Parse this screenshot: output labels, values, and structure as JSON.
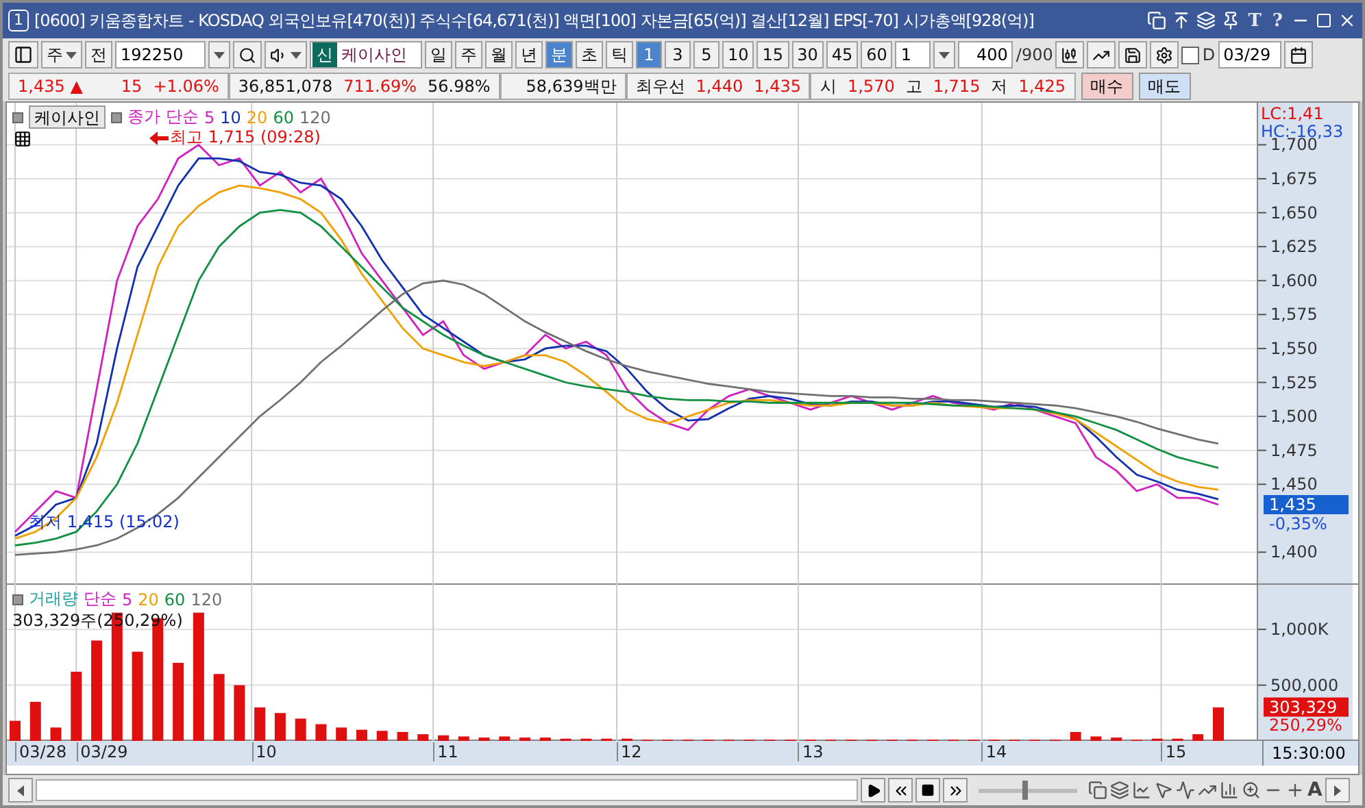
{
  "window": {
    "number": "1",
    "title": "[0600] 키움종합차트 - KOSDAQ 외국인보유[470(천)] 주식수[64,671(천)] 액면[100] 자본금[65(억)] 결산[12월] EPS[-70] 시가총액[928(억)]",
    "text_buttons": [
      "T",
      "?"
    ]
  },
  "toolbar": {
    "market": "주",
    "prev": "전",
    "code": "192250",
    "badge": "신",
    "name": "케이사인",
    "periods": [
      {
        "label": "일",
        "selected": false
      },
      {
        "label": "주",
        "selected": false
      },
      {
        "label": "월",
        "selected": false
      },
      {
        "label": "년",
        "selected": false
      },
      {
        "label": "분",
        "selected": true
      },
      {
        "label": "초",
        "selected": false
      },
      {
        "label": "틱",
        "selected": false
      }
    ],
    "intervals": [
      {
        "label": "1",
        "selected": true
      },
      {
        "label": "3",
        "selected": false
      },
      {
        "label": "5",
        "selected": false
      },
      {
        "label": "10",
        "selected": false
      },
      {
        "label": "15",
        "selected": false
      },
      {
        "label": "30",
        "selected": false
      },
      {
        "label": "45",
        "selected": false
      },
      {
        "label": "60",
        "selected": false
      }
    ],
    "unit": "1",
    "count": "400",
    "max": "/900",
    "d_checkbox": {
      "label": "D",
      "checked": false
    },
    "date": "03/29"
  },
  "quote": {
    "price": "1,435",
    "direction": "▲",
    "change": "15",
    "rate": "+1.06%",
    "volume": "36,851,078",
    "volume_rate": "711.69%",
    "turnover": "56.98%",
    "amount": "58,639백만",
    "best_label": "최우선",
    "best_ask": "1,440",
    "best_bid": "1,435",
    "open_label": "시",
    "open": "1,570",
    "high_label": "고",
    "high": "1,715",
    "low_label": "저",
    "low": "1,425"
  },
  "trade_buttons": [
    {
      "label": "매수",
      "kind": "buy"
    },
    {
      "label": "매도",
      "kind": "sell"
    }
  ],
  "price_pane": {
    "stock_button": "케이사인",
    "legend_prefix": [
      "종가",
      "단순"
    ],
    "markers": [
      {
        "text": "최고 1,715 (09:28)",
        "kind": "high"
      },
      {
        "text": "최저 1,415 (15:02)",
        "kind": "low"
      }
    ],
    "lc": "LC:1,41",
    "hc": "HC:-16,33",
    "current": "1,435",
    "current_rate": "-0,35%",
    "chart_data": {
      "type": "line",
      "grid": true,
      "ylim": [
        1376,
        1731
      ],
      "yticks": [
        {
          "value": 1400,
          "label": "1,400"
        },
        {
          "value": 1450,
          "label": "1,450"
        },
        {
          "value": 1475,
          "label": "1,475"
        },
        {
          "value": 1500,
          "label": "1,500"
        },
        {
          "value": 1525,
          "label": "1,525"
        },
        {
          "value": 1550,
          "label": "1,550"
        },
        {
          "value": 1575,
          "label": "1,575"
        },
        {
          "value": 1600,
          "label": "1,600"
        },
        {
          "value": 1625,
          "label": "1,625"
        },
        {
          "value": 1650,
          "label": "1,650"
        },
        {
          "value": 1675,
          "label": "1,675"
        },
        {
          "value": 1700,
          "label": "1,700"
        }
      ],
      "series": [
        {
          "name": "5",
          "color": "#d020c0",
          "values": [
            1415,
            1430,
            1445,
            1440,
            1520,
            1600,
            1640,
            1660,
            1690,
            1700,
            1685,
            1690,
            1670,
            1680,
            1665,
            1675,
            1650,
            1620,
            1600,
            1580,
            1560,
            1570,
            1545,
            1535,
            1540,
            1545,
            1560,
            1550,
            1555,
            1545,
            1520,
            1505,
            1495,
            1490,
            1505,
            1515,
            1520,
            1515,
            1510,
            1505,
            1510,
            1515,
            1510,
            1505,
            1510,
            1515,
            1510,
            1508,
            1505,
            1510,
            1505,
            1500,
            1495,
            1470,
            1460,
            1445,
            1450,
            1440,
            1440,
            1435
          ]
        },
        {
          "name": "10",
          "color": "#1030b0",
          "values": [
            1412,
            1420,
            1435,
            1440,
            1480,
            1550,
            1610,
            1640,
            1670,
            1690,
            1690,
            1688,
            1680,
            1678,
            1672,
            1670,
            1660,
            1640,
            1615,
            1595,
            1575,
            1565,
            1555,
            1545,
            1540,
            1542,
            1550,
            1552,
            1552,
            1548,
            1535,
            1518,
            1505,
            1497,
            1498,
            1506,
            1513,
            1515,
            1513,
            1509,
            1508,
            1511,
            1511,
            1508,
            1508,
            1511,
            1511,
            1509,
            1507,
            1508,
            1507,
            1503,
            1498,
            1485,
            1470,
            1457,
            1452,
            1446,
            1443,
            1439
          ]
        },
        {
          "name": "20",
          "color": "#f0a000",
          "values": [
            1410,
            1415,
            1425,
            1440,
            1470,
            1510,
            1560,
            1610,
            1640,
            1655,
            1665,
            1670,
            1668,
            1665,
            1660,
            1650,
            1630,
            1605,
            1585,
            1565,
            1550,
            1545,
            1540,
            1537,
            1540,
            1545,
            1545,
            1540,
            1530,
            1518,
            1505,
            1498,
            1495,
            1500,
            1505,
            1510,
            1512,
            1512,
            1510,
            1508,
            1508,
            1510,
            1510,
            1508,
            1508,
            1510,
            1508,
            1507,
            1506,
            1506,
            1505,
            1502,
            1498,
            1488,
            1478,
            1468,
            1458,
            1452,
            1448,
            1446
          ]
        },
        {
          "name": "60",
          "color": "#109040",
          "values": [
            1405,
            1407,
            1410,
            1415,
            1430,
            1450,
            1480,
            1520,
            1560,
            1600,
            1625,
            1640,
            1650,
            1652,
            1650,
            1640,
            1625,
            1610,
            1595,
            1580,
            1570,
            1560,
            1552,
            1545,
            1540,
            1535,
            1530,
            1525,
            1522,
            1520,
            1518,
            1515,
            1513,
            1512,
            1512,
            1511,
            1511,
            1510,
            1510,
            1510,
            1510,
            1510,
            1510,
            1510,
            1510,
            1509,
            1508,
            1508,
            1507,
            1506,
            1505,
            1503,
            1500,
            1495,
            1490,
            1483,
            1476,
            1470,
            1466,
            1462
          ]
        },
        {
          "name": "120",
          "color": "#707070",
          "values": [
            1398,
            1399,
            1400,
            1402,
            1405,
            1410,
            1418,
            1428,
            1440,
            1455,
            1470,
            1485,
            1500,
            1512,
            1525,
            1540,
            1552,
            1565,
            1578,
            1590,
            1598,
            1600,
            1597,
            1590,
            1580,
            1570,
            1562,
            1555,
            1548,
            1542,
            1537,
            1533,
            1530,
            1527,
            1524,
            1522,
            1520,
            1518,
            1517,
            1516,
            1515,
            1515,
            1514,
            1514,
            1513,
            1513,
            1512,
            1512,
            1511,
            1510,
            1509,
            1508,
            1506,
            1503,
            1500,
            1496,
            1491,
            1487,
            1483,
            1480
          ]
        }
      ]
    }
  },
  "volume_pane": {
    "legend": [
      {
        "text": "단순",
        "color": "#d020c0"
      },
      {
        "text": "5",
        "color": "#d020c0"
      },
      {
        "text": "20",
        "color": "#f0a000"
      },
      {
        "text": "60",
        "color": "#109040"
      },
      {
        "text": "120",
        "color": "#707070"
      }
    ],
    "reading": "303,329주(250,29%)",
    "current": "303,329",
    "current_rate": "250,29%",
    "chart_data": {
      "type": "bar",
      "grid": true,
      "ylim": [
        0,
        1400000
      ],
      "yticks": [
        {
          "value": 500000,
          "label": "500,000"
        },
        {
          "value": 1000000,
          "label": "1,000K"
        }
      ],
      "series": [
        {
          "name": "거래량",
          "color": "#e01010",
          "values": [
            180000,
            350000,
            120000,
            620000,
            900000,
            1150000,
            800000,
            1100000,
            700000,
            1150000,
            600000,
            500000,
            300000,
            250000,
            200000,
            150000,
            120000,
            100000,
            90000,
            80000,
            60000,
            50000,
            40000,
            30000,
            40000,
            30000,
            30000,
            20000,
            20000,
            20000,
            20000,
            10000,
            10000,
            10000,
            10000,
            10000,
            10000,
            10000,
            10000,
            10000,
            10000,
            10000,
            10000,
            10000,
            10000,
            10000,
            10000,
            10000,
            10000,
            10000,
            10000,
            10000,
            80000,
            40000,
            30000,
            10000,
            20000,
            20000,
            60000,
            300000
          ]
        }
      ]
    }
  },
  "time_axis": {
    "labels": [
      "03/28",
      "03/29",
      "10",
      "11",
      "12",
      "13",
      "14",
      "15"
    ],
    "end_time": "15:30:00"
  },
  "replay": {
    "level": 0.47
  },
  "bottom_tools": {
    "font_button": "A"
  }
}
